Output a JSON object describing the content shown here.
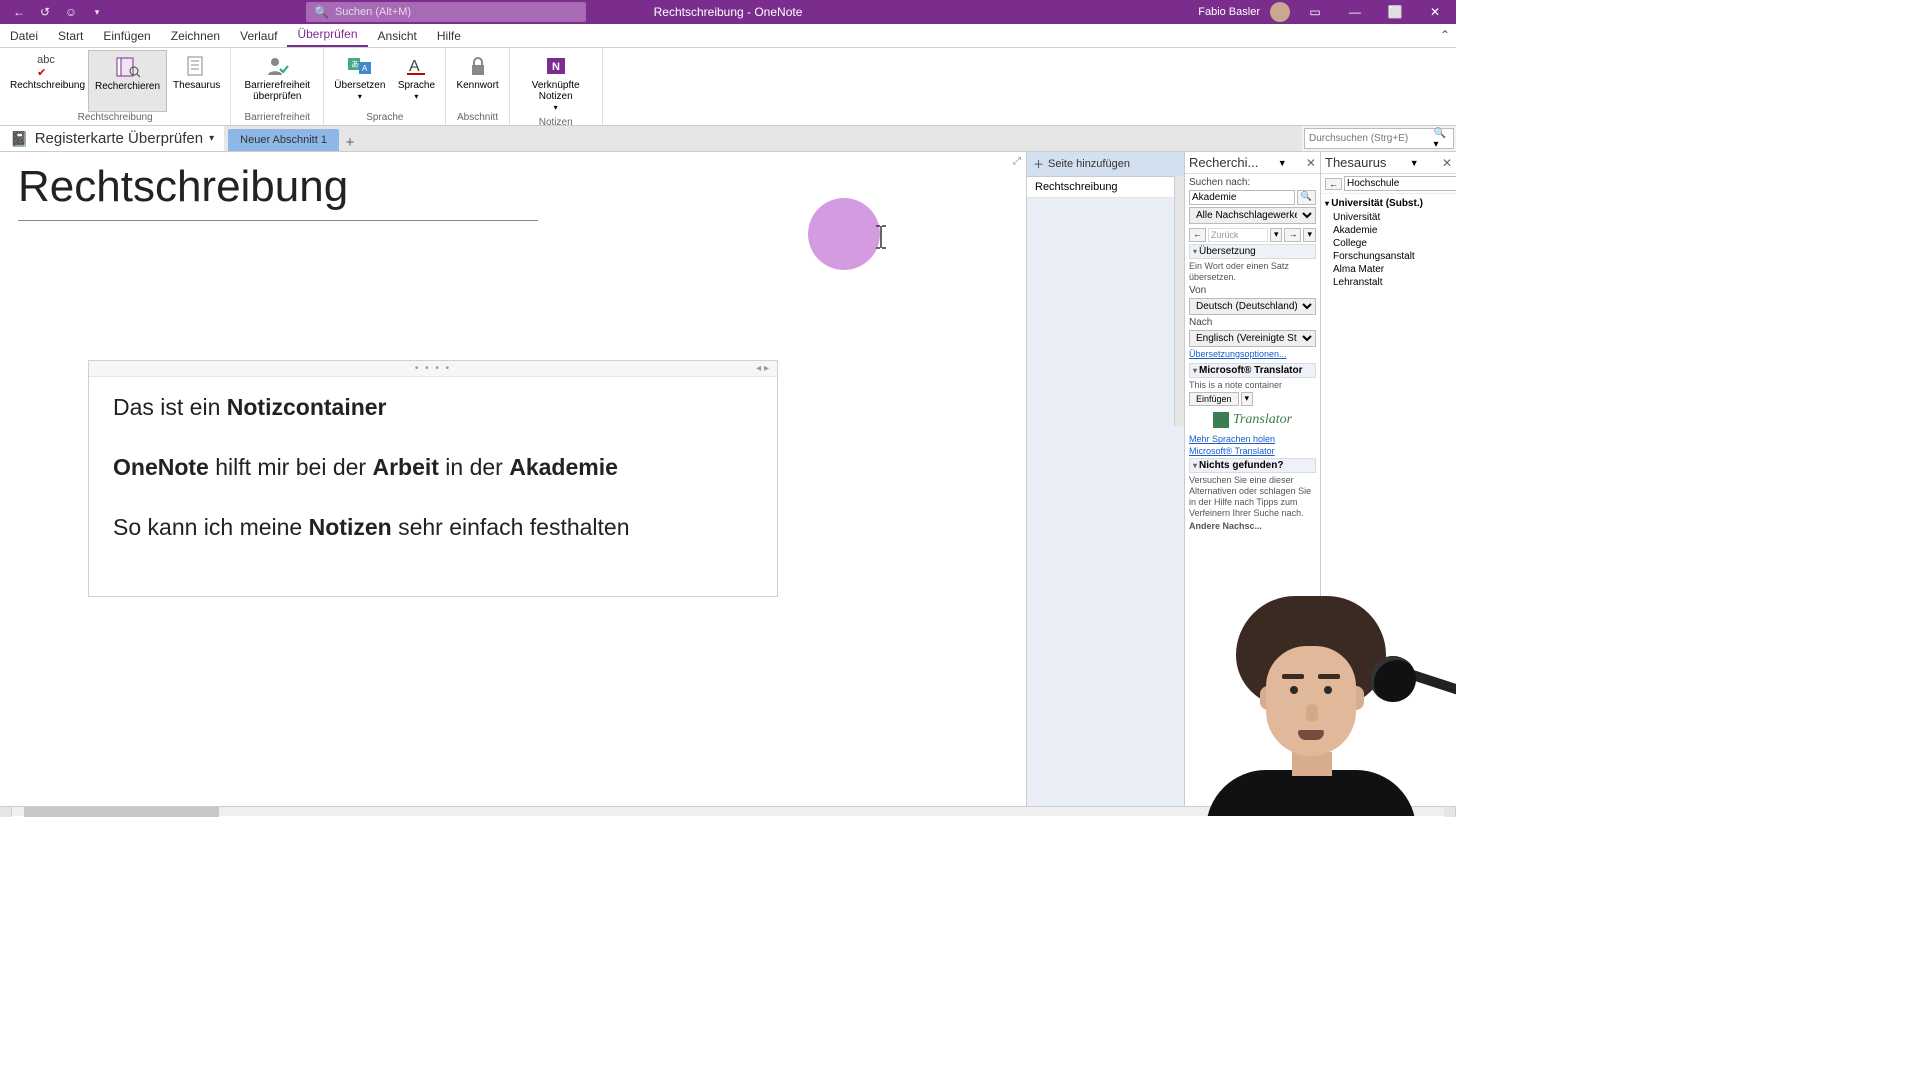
{
  "titlebar": {
    "title": "Rechtschreibung - OneNote",
    "search_placeholder": "Suchen (Alt+M)",
    "user": "Fabio Basler"
  },
  "menu": [
    "Datei",
    "Start",
    "Einfügen",
    "Zeichnen",
    "Verlauf",
    "Überprüfen",
    "Ansicht",
    "Hilfe"
  ],
  "menu_active": 5,
  "ribbon": [
    {
      "label": "Rechtschreibung",
      "items": [
        {
          "label": "Rechtschreibung",
          "icon": "abc"
        },
        {
          "label": "Recherchieren",
          "icon": "book-search",
          "selected": true
        },
        {
          "label": "Thesaurus",
          "icon": "book-list"
        }
      ]
    },
    {
      "label": "Barrierefreiheit",
      "items": [
        {
          "label": "Barrierefreiheit überprüfen",
          "icon": "person-check"
        }
      ]
    },
    {
      "label": "Sprache",
      "items": [
        {
          "label": "Übersetzen",
          "icon": "translate",
          "dropdown": true
        },
        {
          "label": "Sprache",
          "icon": "lang-a",
          "dropdown": true
        }
      ]
    },
    {
      "label": "Abschnitt",
      "items": [
        {
          "label": "Kennwort",
          "icon": "lock"
        }
      ]
    },
    {
      "label": "Notizen",
      "items": [
        {
          "label": "Verknüpfte Notizen",
          "icon": "onenote",
          "dropdown": true
        }
      ]
    }
  ],
  "notebook": "Registerkarte Überprüfen",
  "section_tab": "Neuer Abschnitt 1",
  "nav_search_placeholder": "Durchsuchen (Strg+E)",
  "page_title": "Rechtschreibung",
  "add_page": "Seite hinzufügen",
  "page_item": "Rechtschreibung",
  "note": {
    "line1_a": "Das ist ein ",
    "line1_b": "Notizcontainer",
    "line2_a": "OneNote",
    "line2_b": " hilft mir bei der ",
    "line2_c": "Arbeit",
    "line2_d": " in der ",
    "line2_e": "Akademie",
    "line3_a": "So kann ich meine ",
    "line3_b": "Notizen",
    "line3_c": " sehr einfach festhalten"
  },
  "research": {
    "title": "Recherchi...",
    "search_for": "Suchen nach:",
    "search_value": "Akademie",
    "source_value": "Alle Nachschlagewerke",
    "back": "Zurück",
    "sect_translate": "Übersetzung",
    "translate_hint": "Ein Wort oder einen Satz übersetzen.",
    "from": "Von",
    "from_value": "Deutsch (Deutschland)",
    "to": "Nach",
    "to_value": "Englisch (Vereinigte Sta",
    "options": "Übersetzungsoptionen...",
    "mt": "Microsoft® Translator",
    "mt_hint": "This is a note container",
    "insert": "Einfügen",
    "more_langs": "Mehr Sprachen holen",
    "ms_translator": "Microsoft® Translator",
    "not_found": "Nichts gefunden?",
    "not_found_hint": "Versuchen Sie eine dieser Alternativen oder schlagen Sie in der Hilfe nach Tipps zum Verfeinern Ihrer Suche nach.",
    "other": "Andere Nachsc..."
  },
  "thesaurus": {
    "title": "Thesaurus",
    "term": "Hochschule",
    "cat": "Universität (Subst.)",
    "items": [
      "Universität",
      "Akademie",
      "College",
      "Forschungsanstalt",
      "Alma Mater",
      "Lehranstalt"
    ]
  }
}
